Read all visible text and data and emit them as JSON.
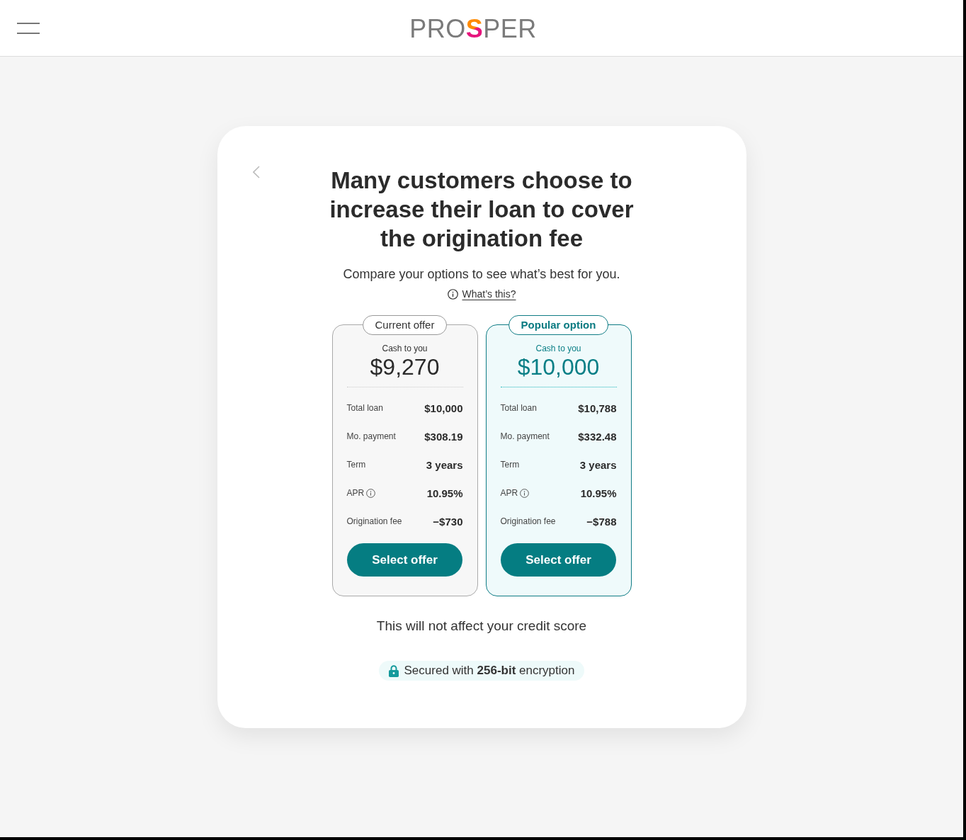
{
  "header": {
    "logo": {
      "start": "PRO",
      "mark": "S",
      "end": "PER"
    }
  },
  "card": {
    "title": "Many customers choose to increase their loan to cover the origination fee",
    "subtitle": "Compare your options to see what’s best for you.",
    "help_link": "What’s this?",
    "offers": [
      {
        "badge": "Current offer",
        "highlighted": false,
        "cash_label": "Cash to you",
        "cash_amount": "$9,270",
        "details": [
          {
            "label": "Total loan",
            "value": "$10,000",
            "info": false
          },
          {
            "label": "Mo. payment",
            "value": "$308.19",
            "info": false
          },
          {
            "label": "Term",
            "value": "3 years",
            "info": false
          },
          {
            "label": "APR",
            "value": "10.95%",
            "info": true
          },
          {
            "label": "Origination fee",
            "value": "−$730",
            "info": false
          }
        ],
        "button": "Select offer"
      },
      {
        "badge": "Popular option",
        "highlighted": true,
        "cash_label": "Cash to you",
        "cash_amount": "$10,000",
        "details": [
          {
            "label": "Total loan",
            "value": "$10,788",
            "info": false
          },
          {
            "label": "Mo. payment",
            "value": "$332.48",
            "info": false
          },
          {
            "label": "Term",
            "value": "3 years",
            "info": false
          },
          {
            "label": "APR",
            "value": "10.95%",
            "info": true
          },
          {
            "label": "Origination fee",
            "value": "−$788",
            "info": false
          }
        ],
        "button": "Select offer"
      }
    ],
    "note": "This will not affect your credit score",
    "security_badge": "Secured with **256-bit** encryption"
  }
}
